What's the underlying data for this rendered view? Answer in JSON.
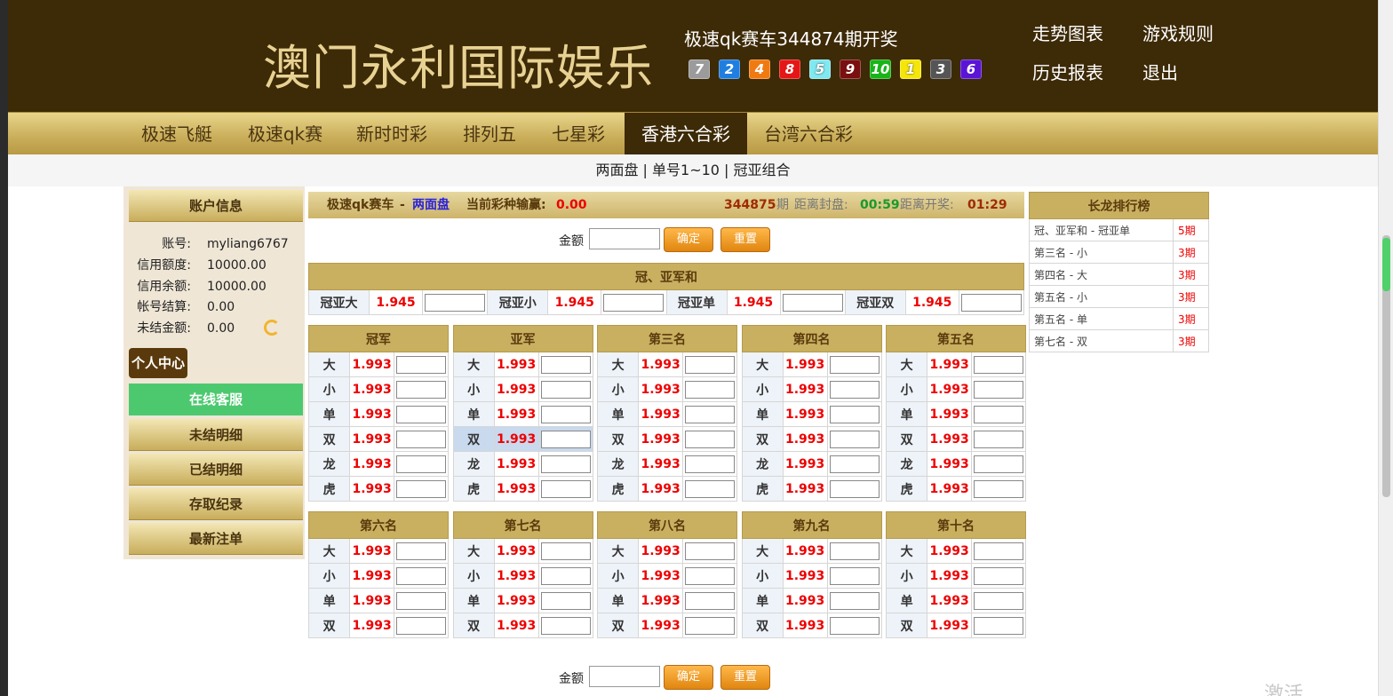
{
  "header": {
    "site_title": "澳门永利国际娱乐",
    "draw_title": "极速qk赛车344874期开奖",
    "balls": [
      {
        "n": "7",
        "c": "#9b9b9b"
      },
      {
        "n": "2",
        "c": "#1f7ee0"
      },
      {
        "n": "4",
        "c": "#f07a12"
      },
      {
        "n": "8",
        "c": "#e51616"
      },
      {
        "n": "5",
        "c": "#7fe8f0"
      },
      {
        "n": "9",
        "c": "#7a0f0f"
      },
      {
        "n": "10",
        "c": "#19b419"
      },
      {
        "n": "1",
        "c": "#f5e60a"
      },
      {
        "n": "3",
        "c": "#555555"
      },
      {
        "n": "6",
        "c": "#5a14d6"
      }
    ],
    "links": [
      "走势图表",
      "游戏规则",
      "历史报表",
      "退出"
    ]
  },
  "nav": [
    "极速飞艇",
    "极速qk赛",
    "新时时彩",
    "排列五",
    "七星彩",
    "香港六合彩",
    "台湾六合彩"
  ],
  "subnav": "两面盘 | 单号1~10 | 冠亚组合",
  "account": {
    "title": "账户信息",
    "rows": [
      {
        "l": "账号:",
        "v": "myliang6767"
      },
      {
        "l": "信用额度:",
        "v": "10000.00"
      },
      {
        "l": "信用余额:",
        "v": "10000.00"
      },
      {
        "l": "帐号结算:",
        "v": "0.00"
      },
      {
        "l": "未结金额:",
        "v": "0.00"
      }
    ],
    "center": "个人中心",
    "service": "在线客服",
    "menu": [
      "未结明细",
      "已结明细",
      "存取纪录",
      "最新注单"
    ]
  },
  "info": {
    "game": "极速qk赛车",
    "sep": "-",
    "mode": "两面盘",
    "pl_label": "当前彩种输赢:",
    "pl": "0.00",
    "period": "344875",
    "period_unit": "期",
    "close_label": "距离封盘:",
    "close": "00:59",
    "open_label": "距离开奖:",
    "open": "01:29"
  },
  "bet": {
    "amount_label": "金额",
    "confirm": "确定",
    "reset": "重置"
  },
  "gyh": {
    "title": "冠、亚军和",
    "cells": [
      {
        "n": "冠亚大",
        "o": "1.945"
      },
      {
        "n": "冠亚小",
        "o": "1.945"
      },
      {
        "n": "冠亚单",
        "o": "1.945"
      },
      {
        "n": "冠亚双",
        "o": "1.945"
      }
    ]
  },
  "top_group": {
    "titles": [
      "冠军",
      "亚军",
      "第三名",
      "第四名",
      "第五名"
    ],
    "opts": [
      "大",
      "小",
      "单",
      "双",
      "龙",
      "虎"
    ],
    "odds": "1.993"
  },
  "bottom_group": {
    "titles": [
      "第六名",
      "第七名",
      "第八名",
      "第九名",
      "第十名"
    ],
    "opts": [
      "大",
      "小",
      "单",
      "双"
    ],
    "odds": "1.993"
  },
  "ranking": {
    "title": "长龙排行榜",
    "rows": [
      {
        "n": "冠、亚军和 - 冠亚单",
        "p": "5期"
      },
      {
        "n": "第三名 - 小",
        "p": "3期"
      },
      {
        "n": "第四名 - 大",
        "p": "3期"
      },
      {
        "n": "第五名 - 小",
        "p": "3期"
      },
      {
        "n": "第五名 - 单",
        "p": "3期"
      },
      {
        "n": "第七名 - 双",
        "p": "3期"
      }
    ]
  },
  "watermark": "激活 Windows"
}
